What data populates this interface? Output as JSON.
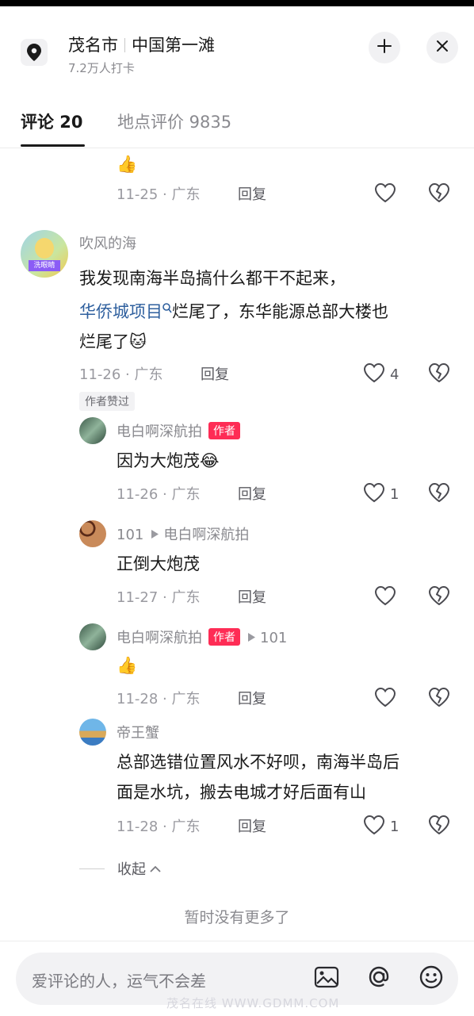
{
  "header": {
    "city": "茂名市",
    "place": "中国第一滩",
    "checkins": "7.2万人打卡"
  },
  "tabs": [
    {
      "label": "评论 20"
    },
    {
      "label": "地点评价 9835"
    }
  ],
  "comments": [
    {
      "name": "",
      "text": "👍",
      "date": "11-25 · 广东",
      "reply": "回复",
      "likes": ""
    },
    {
      "name": "吹风的海",
      "text_a": "我发现南海半岛搞什么都干不起来，",
      "link": "华侨城项目",
      "text_b": "烂尾了，东华能源总部大楼也",
      "text_c": "烂尾了🐱",
      "date": "11-26 · 广东",
      "reply": "回复",
      "likes": "4",
      "tag": "作者赞过",
      "avatar_text": "洗眼睛"
    },
    {
      "name": "电白啊深航拍",
      "badge": "作者",
      "text": "因为大炮茂😂",
      "date": "11-26 · 广东",
      "reply": "回复",
      "likes": "1"
    },
    {
      "name": "101",
      "reply_to": "电白啊深航拍",
      "text": "正倒大炮茂",
      "date": "11-27 · 广东",
      "reply": "回复",
      "likes": ""
    },
    {
      "name": "电白啊深航拍",
      "badge": "作者",
      "reply_to": "101",
      "text": "👍",
      "date": "11-28 · 广东",
      "reply": "回复",
      "likes": ""
    },
    {
      "name": "帝王蟹",
      "text_a": "总部选错位置风水不好呗，南海半岛后",
      "text_b": "面是水坑，搬去电城才好后面有山",
      "date": "11-28 · 广东",
      "reply": "回复",
      "likes": "1"
    }
  ],
  "collapse_label": "收起",
  "no_more": "暂时没有更多了",
  "input": {
    "placeholder": "爱评论的人，运气不会差"
  },
  "watermark": "茂名在线 WWW.GDMM.COM",
  "icons": [
    "location-pin-icon",
    "minimize-icon",
    "close-icon",
    "heart-icon",
    "broken-heart-icon",
    "image-icon",
    "at-icon",
    "emoji-icon",
    "chevron-up-icon",
    "play-arrow-icon"
  ],
  "colors": {
    "accent": "#fe2c55",
    "link": "#2e5f9e",
    "meta": "#9a9aa0"
  }
}
